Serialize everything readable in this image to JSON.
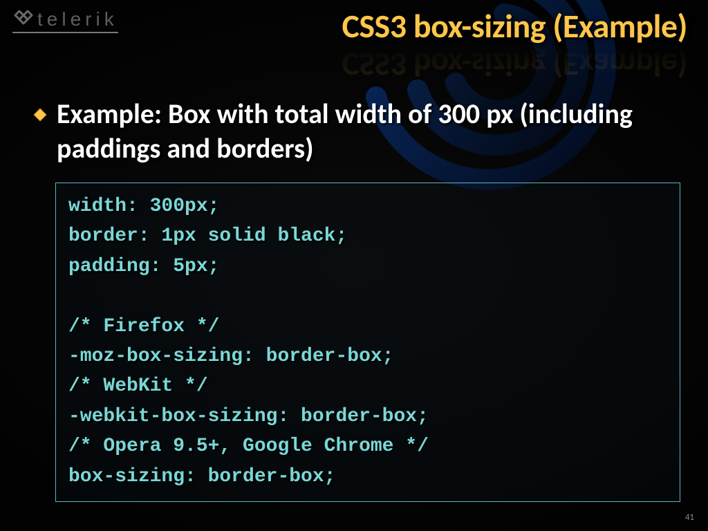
{
  "logo": {
    "text": "telerik"
  },
  "title": "CSS3 box-sizing (Example)",
  "bullet": "Example: Box with total width of 300 px (including paddings and borders)",
  "code": "width: 300px;\nborder: 1px solid black;\npadding: 5px;\n\n/* Firefox */\n-moz-box-sizing: border-box;\n/* WebKit */\n-webkit-box-sizing: border-box;\n/* Opera 9.5+, Google Chrome */\nbox-sizing: border-box;",
  "page_number": "41"
}
